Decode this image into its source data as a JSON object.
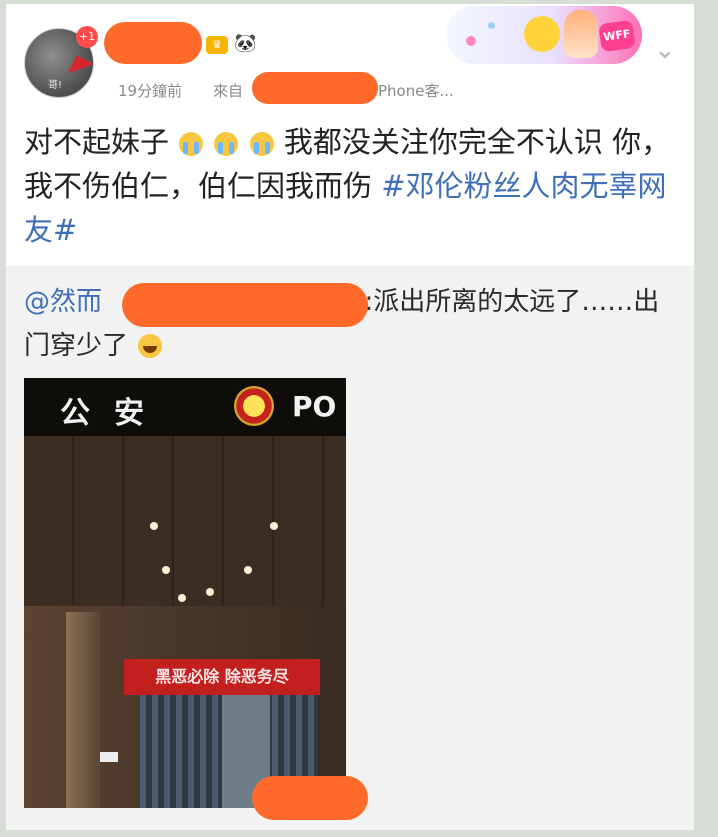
{
  "post": {
    "avatar_caption": "哥!",
    "badge_count": "+1",
    "time": "19分鐘前",
    "source_prefix": "來自",
    "source_suffix": "Phone客...",
    "content": {
      "line1_text_a": "对不起妹子",
      "line1_text_b": "我都没关注你完全不认识",
      "line2_text": "你，我不伤伯仁，伯仁因我而伤",
      "topic": "#邓伦粉丝人肉无辜网友#"
    }
  },
  "banner": {
    "logo_text": "WFF"
  },
  "repost": {
    "mention_prefix": "@然而",
    "text": ":派出所离的太远了……出门穿少了"
  },
  "photo": {
    "sign_chinese": "公安",
    "sign_english": "PO",
    "banner_text": "黑恶必除 除恶务尽"
  },
  "colors": {
    "topic_blue": "#3f6fb8",
    "redaction_orange": "#ff6a2b",
    "background_green": "#d6ddd4"
  },
  "icons": {
    "vip": "crown-icon",
    "panda": "panda-icon",
    "more": "chevron-down-icon",
    "cry": "crying-face-icon",
    "laugh": "laugh-tears-icon"
  }
}
